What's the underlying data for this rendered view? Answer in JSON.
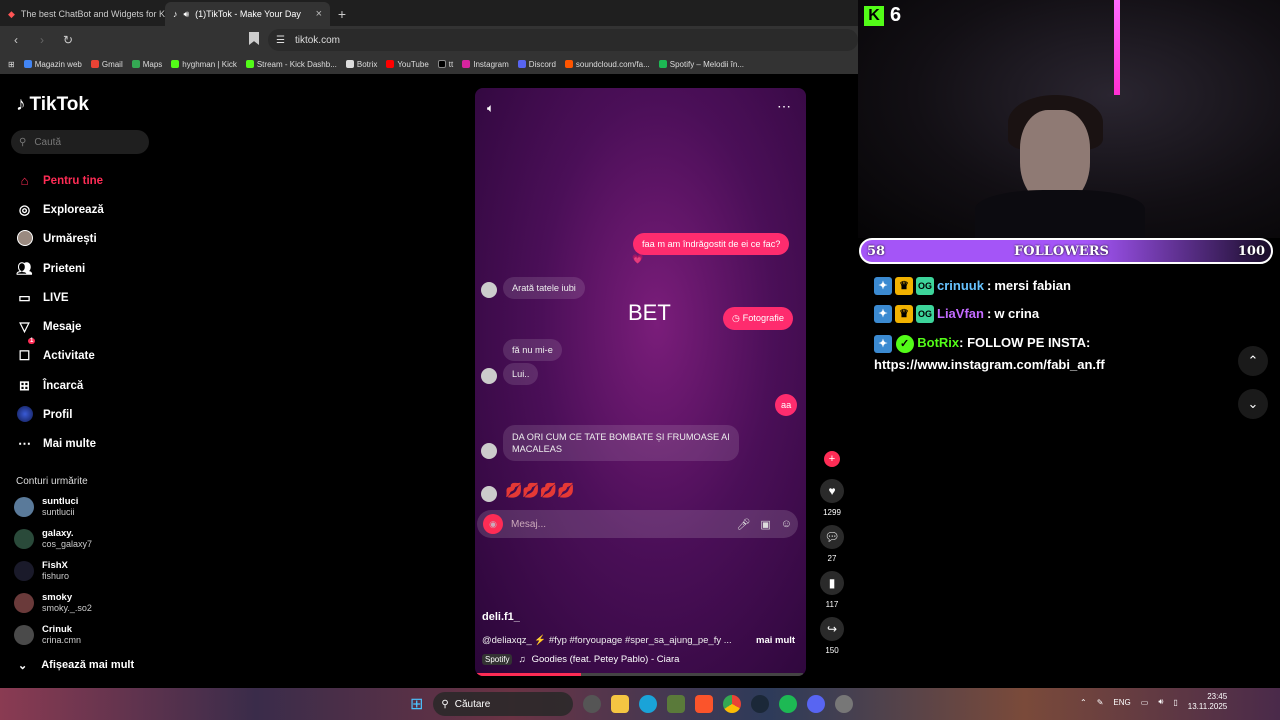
{
  "browser": {
    "tabs": [
      {
        "title": "The best ChatBot and Widgets for Kick"
      },
      {
        "title": "(1)TikTok - Make Your Day"
      }
    ],
    "new_tab": "+",
    "url": "tiktok.com",
    "bookmarks": [
      "Magazin web",
      "Gmail",
      "Maps",
      "hyghman | Kick",
      "Stream - Kick Dashb...",
      "Botrix",
      "YouTube",
      "tt",
      "Instagram",
      "Discord",
      "soundcloud.com/fa...",
      "Spotify – Melodii în..."
    ]
  },
  "tiktok": {
    "logo": "TikTok",
    "search_placeholder": "Caută",
    "menu": [
      {
        "label": "Pentru tine",
        "icon": "home-icon"
      },
      {
        "label": "Explorează",
        "icon": "compass-icon"
      },
      {
        "label": "Urmărești",
        "icon": "following-icon"
      },
      {
        "label": "Prieteni",
        "icon": "friends-icon"
      },
      {
        "label": "LIVE",
        "icon": "live-icon"
      },
      {
        "label": "Mesaje",
        "icon": "messages-icon"
      },
      {
        "label": "Activitate",
        "icon": "activity-icon"
      },
      {
        "label": "Încarcă",
        "icon": "upload-icon"
      },
      {
        "label": "Profil",
        "icon": "profile-icon"
      },
      {
        "label": "Mai multe",
        "icon": "more-icon"
      }
    ],
    "activity_badge": "1",
    "following_title": "Conturi urmărite",
    "accounts": [
      {
        "name": "suntluci",
        "user": "suntlucii"
      },
      {
        "name": "galaxy.",
        "user": "cos_galaxy7"
      },
      {
        "name": "FishX",
        "user": "fishuro"
      },
      {
        "name": "smoky",
        "user": "smoky._.so2"
      },
      {
        "name": "Crinuk",
        "user": "crina.cmn"
      }
    ],
    "show_more": "Afișează mai mult"
  },
  "video": {
    "chat": {
      "m1": "faa m am îndrăgostit de ei ce fac?",
      "m2": "Arată tatele iubi",
      "m3": "Fotografie",
      "m4": "fă nu mi-e",
      "m5": "Lui..",
      "m6": "aa",
      "m7": "DA ORI CUM CE TATE BOMBATE ȘI FRUMOASE AI MACALEAS"
    },
    "lips": "💋💋💋💋",
    "overlay_text": "BET",
    "message_placeholder": "Mesaj...",
    "author": "deli.f1_",
    "description": "@deliaxqz_ ⚡ #fyp #foryoupage #sper_sa_ajung_pe_fy ...",
    "more": "mai mult",
    "spotify": "Spotify",
    "music": "Goodies (feat. Petey Pablo) - Ciara",
    "progress": 0.32
  },
  "actions": {
    "likes": "1299",
    "comments": "27",
    "saves": "117",
    "shares": "150"
  },
  "stream": {
    "kick_count": "6",
    "goal": {
      "current": "58",
      "label": "FOLLOWERS",
      "target": "100"
    },
    "chat": [
      {
        "user": "crinuuk",
        "text": "mersi fabian",
        "color": "#67c3ff"
      },
      {
        "user": "LiaVfan",
        "text": "w crina",
        "color": "#c36bff"
      },
      {
        "user": "BotRix",
        "text": "FOLLOW PE INSTA: https://www.instagram.com/fabi_an.ff",
        "color": "#53fc18"
      }
    ]
  },
  "taskbar": {
    "search": "Căutare",
    "lang": "ENG",
    "time": "23:45",
    "date": "13.11.2025"
  }
}
